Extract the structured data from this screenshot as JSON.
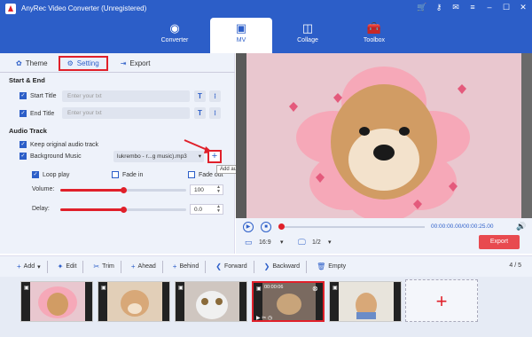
{
  "app": {
    "title": "AnyRec Video Converter (Unregistered)"
  },
  "nav": {
    "tabs": [
      {
        "label": "Converter"
      },
      {
        "label": "MV"
      },
      {
        "label": "Collage"
      },
      {
        "label": "Toolbox"
      }
    ]
  },
  "subtabs": [
    {
      "label": "Theme"
    },
    {
      "label": "Setting"
    },
    {
      "label": "Export"
    }
  ],
  "start_end": {
    "heading": "Start & End",
    "start_label": "Start Title",
    "end_label": "End Title",
    "placeholder": "Enter your txt",
    "t_button": "T",
    "align_button": "⁝"
  },
  "audio": {
    "heading": "Audio Track",
    "keep_original": "Keep original audio track",
    "background_music": "Background Music",
    "music_file": "lukrembo - r...g music).mp3",
    "add_tooltip": "Add audio",
    "loop_play": "Loop play",
    "fade_in": "Fade in",
    "fade_out": "Fade out",
    "volume_label": "Volume:",
    "volume_value": "100",
    "volume_fraction": 0.5,
    "delay_label": "Delay:",
    "delay_value": "0.0",
    "delay_fraction": 0.5
  },
  "player": {
    "time": "00:00:00.00/00:00:25.00",
    "ratio": "16:9",
    "pages": "1/2",
    "export_label": "Export"
  },
  "toolbar": {
    "add": "Add",
    "edit": "Edit",
    "trim": "Trim",
    "ahead": "Ahead",
    "behind": "Behind",
    "forward": "Forward",
    "backward": "Backward",
    "empty": "Empty",
    "counter": "4 / 5"
  },
  "thumbnail_time": "00:00:06",
  "colors": {
    "brand_blue": "#2c5ec8",
    "accent_red": "#e0202a",
    "panel_bg": "#eef2fa"
  }
}
